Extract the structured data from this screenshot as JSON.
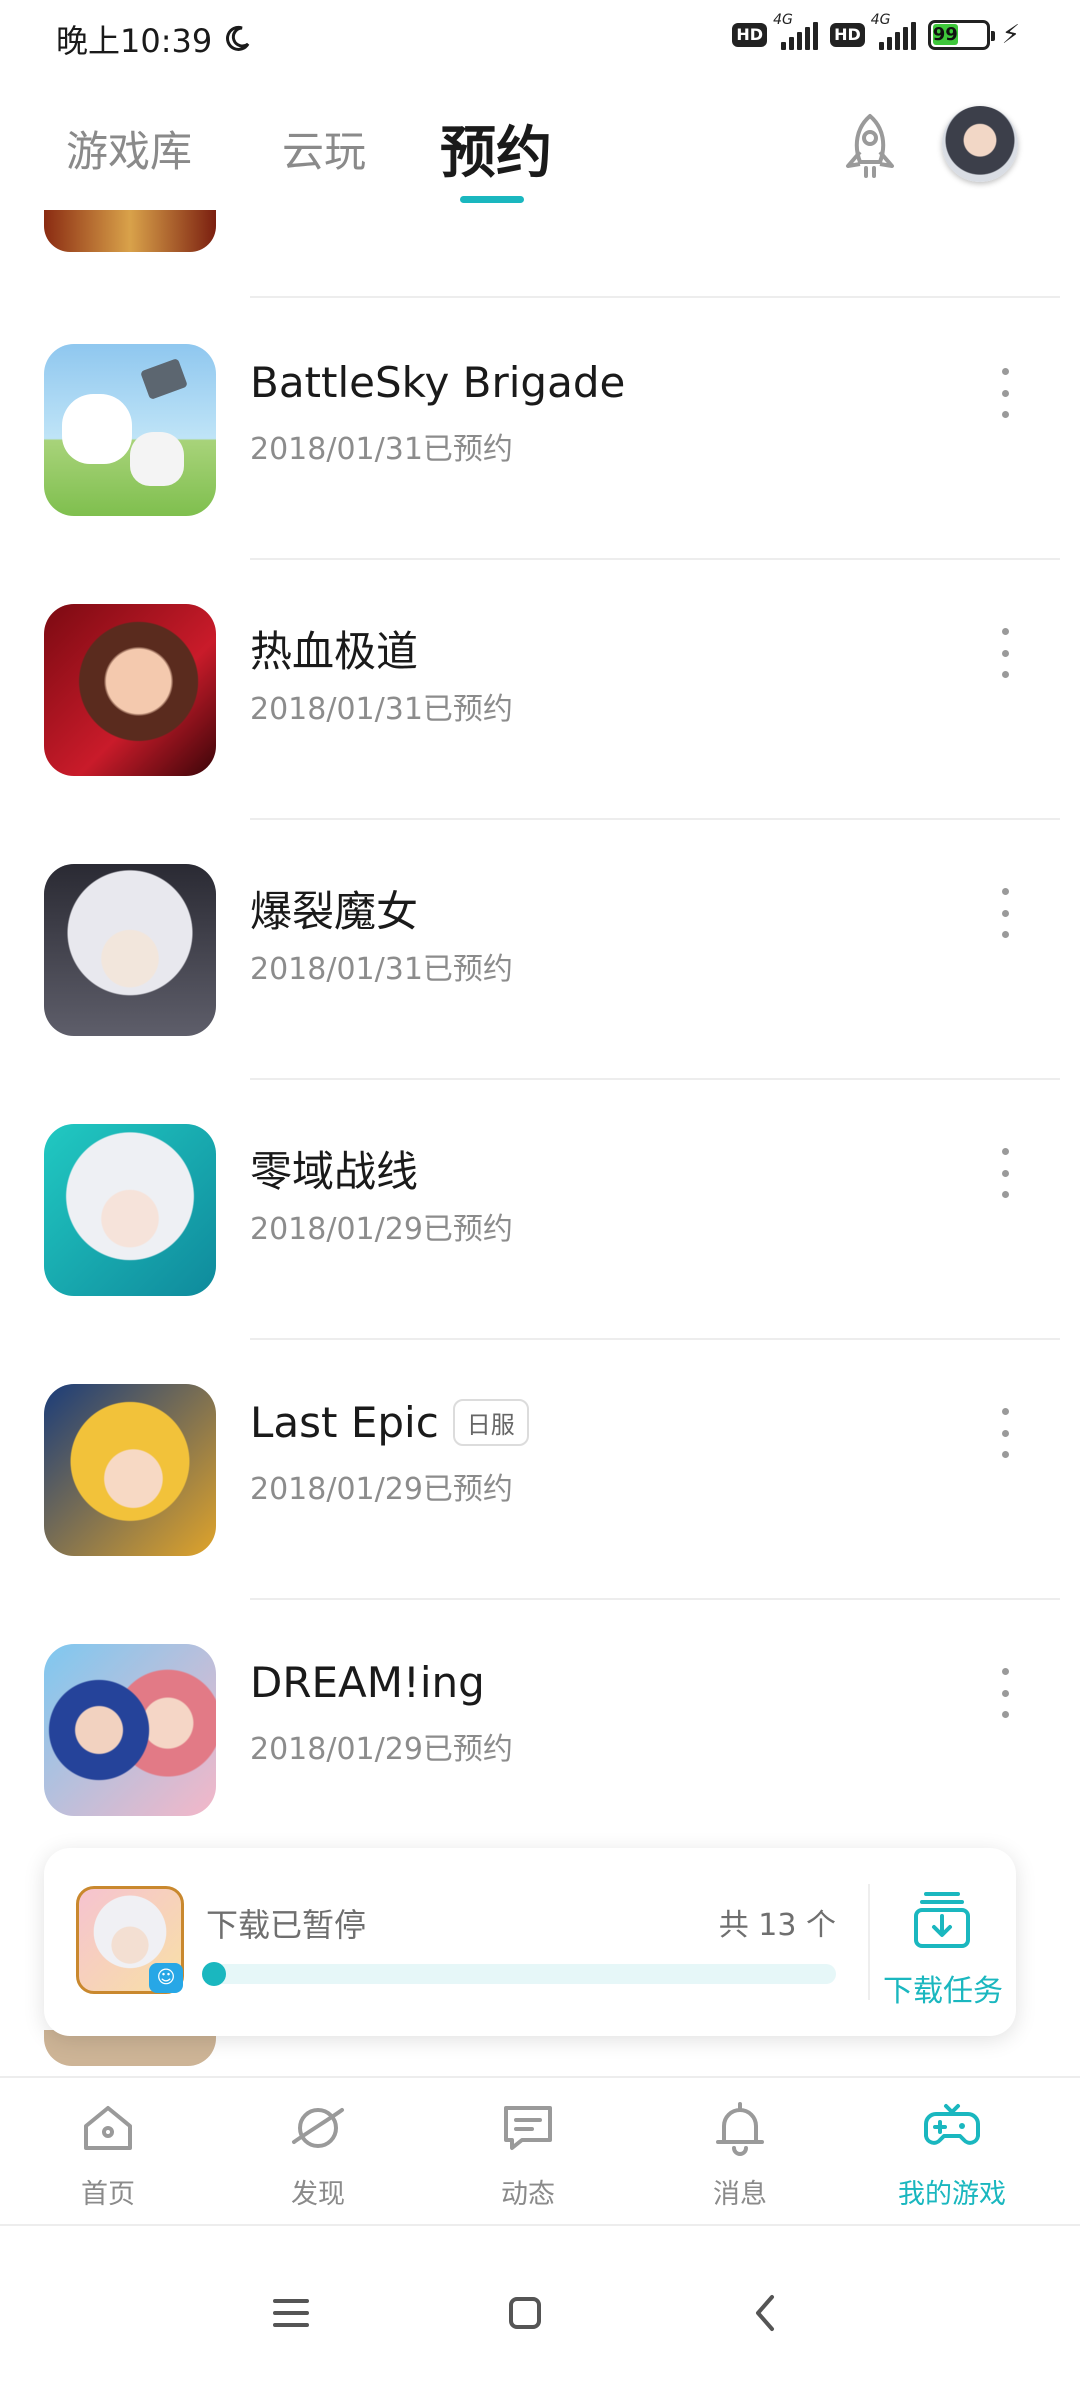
{
  "status_bar": {
    "time": "晚上10:39",
    "hd_label": "HD",
    "network_label": "4G",
    "battery": "99"
  },
  "top_tabs": [
    "游戏库",
    "云玩",
    "预约"
  ],
  "active_tab_index": 2,
  "list": [
    {
      "title": "BattleSky Brigade",
      "date": "2018/01/31已预约",
      "tag": ""
    },
    {
      "title": "热血极道",
      "date": "2018/01/31已预约",
      "tag": ""
    },
    {
      "title": "爆裂魔女",
      "date": "2018/01/31已预约",
      "tag": ""
    },
    {
      "title": "零域战线",
      "date": "2018/01/29已预约",
      "tag": ""
    },
    {
      "title": "Last Epic",
      "date": "2018/01/29已预约",
      "tag": "日服"
    },
    {
      "title": "DREAM!ing",
      "date": "2018/01/29已预约",
      "tag": ""
    }
  ],
  "download": {
    "status": "下载已暂停",
    "count": "共 13 个",
    "progress": 0.0,
    "task_label": "下载任务",
    "thumb_badge": "☺"
  },
  "bottom_nav": [
    {
      "label": "首页",
      "icon": "home-icon"
    },
    {
      "label": "发现",
      "icon": "planet-icon"
    },
    {
      "label": "动态",
      "icon": "message-icon"
    },
    {
      "label": "消息",
      "icon": "bell-icon"
    },
    {
      "label": "我的游戏",
      "icon": "gamepad-icon"
    }
  ],
  "active_nav_index": 4,
  "colors": {
    "accent": "#1ab7bf",
    "muted": "#8a8a8a",
    "divider": "#ededed"
  }
}
